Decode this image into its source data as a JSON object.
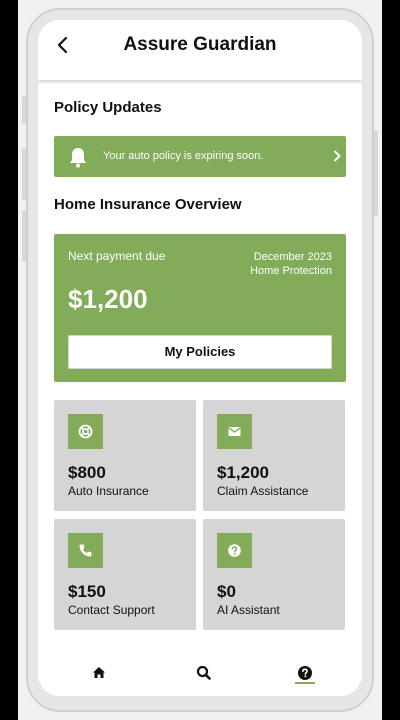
{
  "header": {
    "title": "Assure Guardian"
  },
  "updates": {
    "section_title": "Policy Updates",
    "notice_text": "Your auto policy is expiring soon."
  },
  "overview": {
    "section_title": "Home Insurance Overview",
    "label": "Next payment due",
    "date": "December 2023",
    "policy_type": "Home Protection",
    "amount": "$1,200",
    "button_label": "My Policies"
  },
  "tiles": [
    {
      "value": "$800",
      "label": "Auto Insurance",
      "icon": "lifebuoy-icon"
    },
    {
      "value": "$1,200",
      "label": "Claim Assistance",
      "icon": "envelope-icon"
    },
    {
      "value": "$150",
      "label": "Contact Support",
      "icon": "phone-icon"
    },
    {
      "value": "$0",
      "label": "AI Assistant",
      "icon": "question-icon"
    }
  ],
  "nav": {
    "items": [
      "home-icon",
      "search-icon",
      "help-icon"
    ],
    "active": "help-icon"
  },
  "colors": {
    "accent": "#82ab5a",
    "tile_background": "#d5d5d5"
  }
}
